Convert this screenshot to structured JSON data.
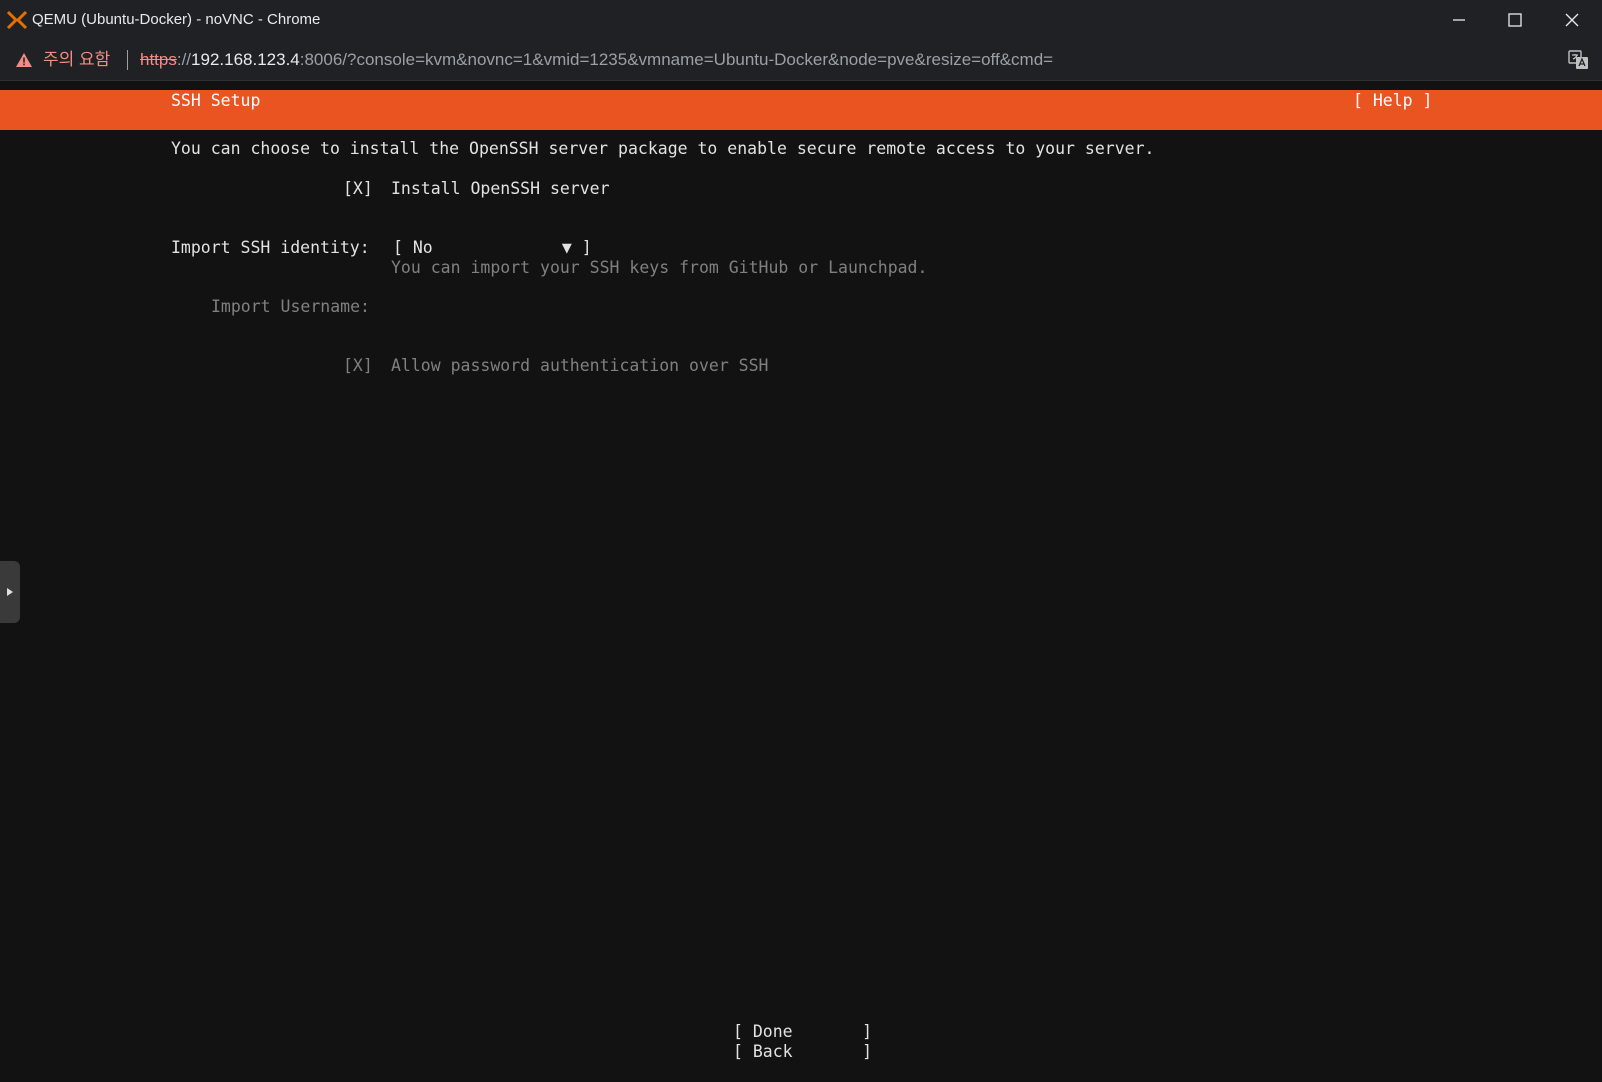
{
  "window": {
    "title": "QEMU (Ubuntu-Docker) - noVNC - Chrome"
  },
  "address_bar": {
    "security_label": "주의 요함",
    "url_scheme": "https",
    "url_separator": "://",
    "url_host": "192.168.123.4",
    "url_rest": ":8006/?console=kvm&novnc=1&vmid=1235&vmname=Ubuntu-Docker&node=pve&resize=off&cmd="
  },
  "installer": {
    "header_title": "SSH Setup",
    "help_label": "[ Help ]",
    "intro_text": "You can choose to install the OpenSSH server package to enable secure remote access to your server.",
    "openssh_checkbox": "[X]",
    "openssh_label": "Install OpenSSH server",
    "identity_label": "Import SSH identity:",
    "identity_open_bracket": "[",
    "identity_value": "No",
    "identity_arrow": "▼",
    "identity_close_bracket": "]",
    "identity_hint": "You can import your SSH keys from GitHub or Launchpad.",
    "username_label": "Import Username:",
    "password_checkbox": "[X]",
    "password_label": "Allow password authentication over SSH",
    "done_label": "[ Done       ]",
    "back_label": "[ Back       ]"
  },
  "colors": {
    "header_band": "#e95420",
    "console_bg": "#121212",
    "chrome_bg": "#202124"
  }
}
